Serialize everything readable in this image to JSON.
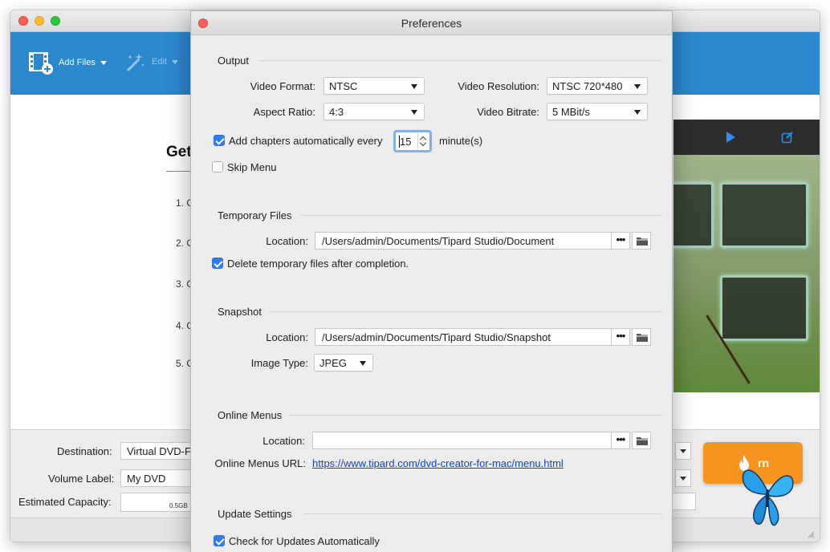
{
  "main_window": {
    "toolbar": {
      "add_files_label": "Add Files",
      "edit_label": "Edit"
    },
    "guide": {
      "title": "Get",
      "steps": [
        "1. C",
        "2. C",
        "3. C",
        "4. C",
        "5. C"
      ]
    },
    "bottom": {
      "destination_label": "Destination:",
      "destination_value": "Virtual DVD-F",
      "volume_label": "Volume Label:",
      "volume_value": "My DVD",
      "capacity_label": "Estimated Capacity:",
      "capacity_tick": "0.5GB",
      "burn_label": "rn"
    }
  },
  "preferences": {
    "title": "Preferences",
    "output": {
      "heading": "Output",
      "video_format_label": "Video Format:",
      "video_format_value": "NTSC",
      "video_resolution_label": "Video Resolution:",
      "video_resolution_value": "NTSC 720*480",
      "aspect_ratio_label": "Aspect Ratio:",
      "aspect_ratio_value": "4:3",
      "video_bitrate_label": "Video Bitrate:",
      "video_bitrate_value": "5 MBit/s",
      "add_chapters_label": "Add chapters automatically every",
      "add_chapters_checked": true,
      "chapter_minutes_value": "15",
      "minutes_unit": "minute(s)",
      "skip_menu_label": "Skip Menu",
      "skip_menu_checked": false
    },
    "temporary_files": {
      "heading": "Temporary Files",
      "location_label": "Location:",
      "location_value": "/Users/admin/Documents/Tipard Studio/Document",
      "delete_label": "Delete temporary files after completion.",
      "delete_checked": true
    },
    "snapshot": {
      "heading": "Snapshot",
      "location_label": "Location:",
      "location_value": "/Users/admin/Documents/Tipard Studio/Snapshot",
      "image_type_label": "Image Type:",
      "image_type_value": "JPEG"
    },
    "online_menus": {
      "heading": "Online Menus",
      "location_label": "Location:",
      "location_value": "",
      "url_label": "Online Menus URL:",
      "url_value": "https://www.tipard.com/dvd-creator-for-mac/menu.html"
    },
    "update_settings": {
      "heading": "Update Settings",
      "check_updates_label": "Check for Updates Automatically",
      "check_updates_checked": true
    },
    "browse_dots": "•••"
  },
  "colors": {
    "toolbar_blue": "#2b88cd",
    "checkbox_blue": "#2e7cf6",
    "link_blue": "#0645d6",
    "burn_orange": "#f7931e"
  }
}
